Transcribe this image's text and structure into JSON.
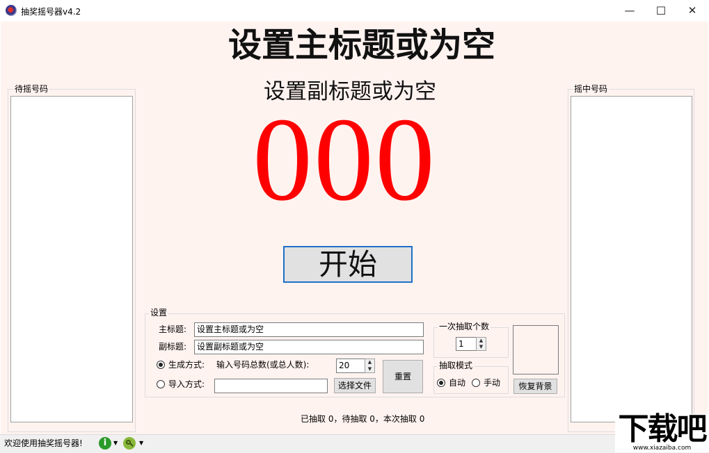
{
  "window": {
    "title": "抽奖摇号器v4.2",
    "minimize_glyph": "—",
    "maximize_glyph": "☐",
    "close_glyph": "✕"
  },
  "display": {
    "main_title": "设置主标题或为空",
    "sub_title": "设置副标题或为空",
    "number": "000",
    "number_color": "#ff0000"
  },
  "left_panel": {
    "label": "待摇号码",
    "items": []
  },
  "right_panel": {
    "label": "摇中号码",
    "items": []
  },
  "start_button": {
    "label": "开始"
  },
  "settings": {
    "group_label": "设置",
    "main_title_label": "主标题:",
    "main_title_value": "设置主标题或为空",
    "sub_title_label": "副标题:",
    "sub_title_value": "设置副标题或为空",
    "generate_label": "生成方式:",
    "generate_selected": true,
    "total_label": "输入号码总数(或总人数):",
    "total_value": "20",
    "import_label": "导入方式:",
    "import_selected": false,
    "import_path": "",
    "choose_file_label": "选择文件",
    "reset_label": "重置",
    "per_draw_group_label": "一次抽取个数",
    "per_draw_value": "1",
    "mode_group_label": "抽取模式",
    "mode_auto_label": "自动",
    "mode_manual_label": "手动",
    "mode_selected": "auto",
    "restore_bg_label": "恢复背景"
  },
  "summary": "已抽取 0，待抽取 0，本次抽取 0",
  "status": {
    "welcome": "欢迎使用抽奖摇号器!"
  },
  "watermark": {
    "text": "下载吧",
    "url": "www.xiazaiba.com"
  },
  "colors": {
    "accent": "#1e6fc8",
    "background": "#fff3f0",
    "info_icon": "#2a9a2a",
    "key_icon": "#8ab83a"
  }
}
